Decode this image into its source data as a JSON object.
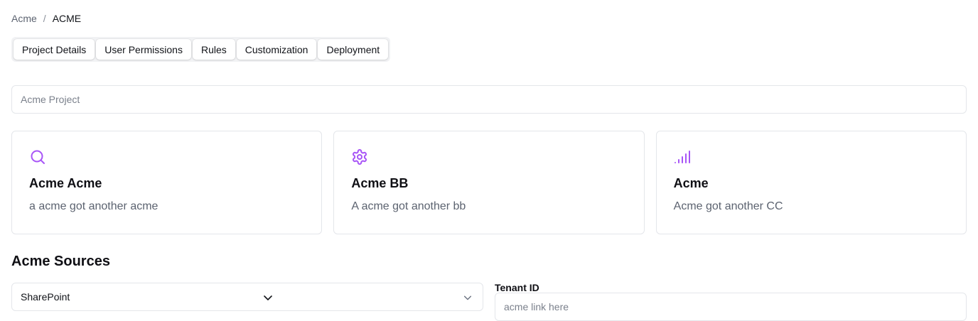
{
  "breadcrumb": {
    "parent": "Acme",
    "separator": "/",
    "current": "ACME"
  },
  "tabs": [
    {
      "label": "Project Details"
    },
    {
      "label": "User Permissions"
    },
    {
      "label": "Rules"
    },
    {
      "label": "Customization"
    },
    {
      "label": "Deployment"
    }
  ],
  "project": {
    "name_placeholder": "Acme Project",
    "name_value": ""
  },
  "cards": [
    {
      "icon": "search-icon",
      "title": "Acme Acme",
      "description": "a acme got another acme"
    },
    {
      "icon": "gear-icon",
      "title": "Acme BB",
      "description": "A acme got another bb"
    },
    {
      "icon": "signal-bars-icon",
      "title": "Acme",
      "description": "Acme got another CC"
    }
  ],
  "sources": {
    "title": "Acme Sources",
    "selected": "SharePoint",
    "tenant_label": "Tenant ID",
    "tenant_placeholder": "acme link here",
    "tenant_value": ""
  },
  "colors": {
    "accent": "#a855f7",
    "border": "#e4e6ea",
    "muted_text": "#5c6370"
  }
}
